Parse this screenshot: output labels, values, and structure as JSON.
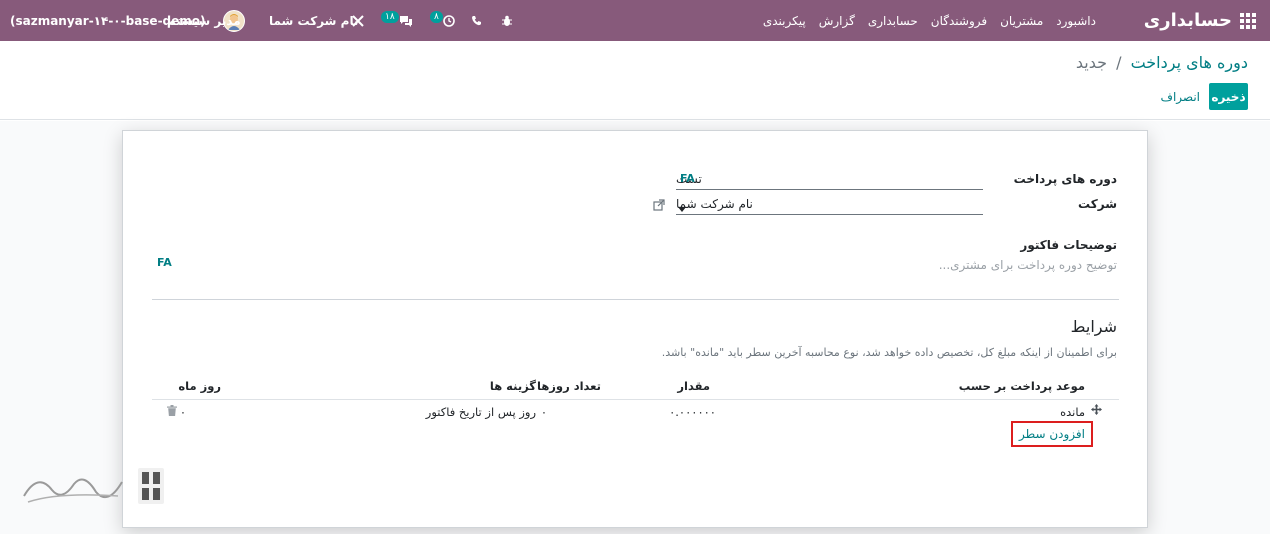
{
  "navbar": {
    "app_title": "حسابداری",
    "menu": [
      "داشبورد",
      "مشتریان",
      "فروشندگان",
      "حسابداری",
      "گزارش",
      "پیکربندی"
    ],
    "activity_count": "۸",
    "messages_count": "۱۸",
    "company_name": "نام شرکت شما",
    "user_name": "مدیر سیستم",
    "database": "(sazmanyar-۱۴-۰-base-demo)"
  },
  "breadcrumb": {
    "parent": "دوره های پرداخت",
    "separator": "/",
    "current": "جدید"
  },
  "buttons": {
    "save": "ذخیره",
    "discard": "انصراف"
  },
  "form": {
    "payment_terms_label": "دوره های پرداخت",
    "payment_terms_value": "تست",
    "lang_badge": "FA",
    "company_label": "شرکت",
    "company_value": "نام شرکت شما",
    "invoice_desc_label": "توضیحات فاکتور",
    "invoice_desc_placeholder": "توضیح دوره پرداخت برای مشتری...",
    "invoice_lang_badge": "FA"
  },
  "terms": {
    "title": "شرایط",
    "hint": "برای اطمینان از اینکه مبلغ کل، تخصیص داده خواهد شد، نوع محاسبه آخرین سطر باید \"مانده\" باشد.",
    "columns": {
      "due_type": "موعد پرداخت بر حسب",
      "amount": "مقدار",
      "days": "تعداد روزها",
      "option": "گزینه ها",
      "day_of_month": "روز ماه"
    },
    "rows": [
      {
        "due_type": "مانده",
        "amount": "۰.۰۰۰۰۰۰",
        "days": "۰",
        "option": "روز پس از تاریخ فاکتور",
        "day_of_month": "۰"
      }
    ],
    "add_line": "افزودن سطر"
  },
  "colors": {
    "navbar": "#875a7b",
    "primary": "#00a09d",
    "link": "#017e84",
    "highlight": "#dc1e1e"
  }
}
